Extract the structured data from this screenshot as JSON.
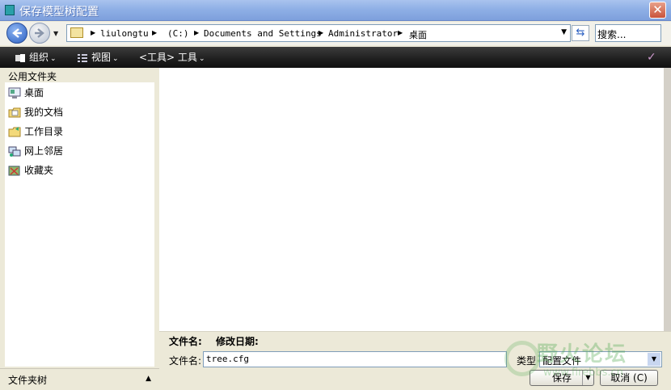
{
  "window": {
    "title": "保存模型树配置",
    "close_label": "✕"
  },
  "address": {
    "breadcrumbs": [
      "liulongtu",
      "(C:)",
      "Documents and Settings",
      "Administrator",
      "桌面"
    ]
  },
  "search": {
    "placeholder": "搜索..."
  },
  "toolbar": {
    "organize_label": "组织",
    "view_label": "视图",
    "tools_label": "<工具> 工具"
  },
  "sidebar": {
    "header": "公用文件夹",
    "items": [
      {
        "label": "桌面",
        "icon": "desktop-icon"
      },
      {
        "label": "我的文档",
        "icon": "documents-icon"
      },
      {
        "label": "工作目录",
        "icon": "working-dir-icon"
      },
      {
        "label": "网上邻居",
        "icon": "network-icon"
      },
      {
        "label": "收藏夹",
        "icon": "favorites-icon"
      }
    ],
    "tree_label": "文件夹树"
  },
  "columns": {
    "name": "文件名:",
    "modified": "修改日期:"
  },
  "form": {
    "filename_label": "文件名:",
    "filename_value": "tree.cfg",
    "type_label": "类型",
    "type_value": "配置文件",
    "save_label": "保存",
    "cancel_label": "取消 (C)"
  },
  "watermark": {
    "text": "野火论坛",
    "url": "www.firebbs.cn"
  }
}
